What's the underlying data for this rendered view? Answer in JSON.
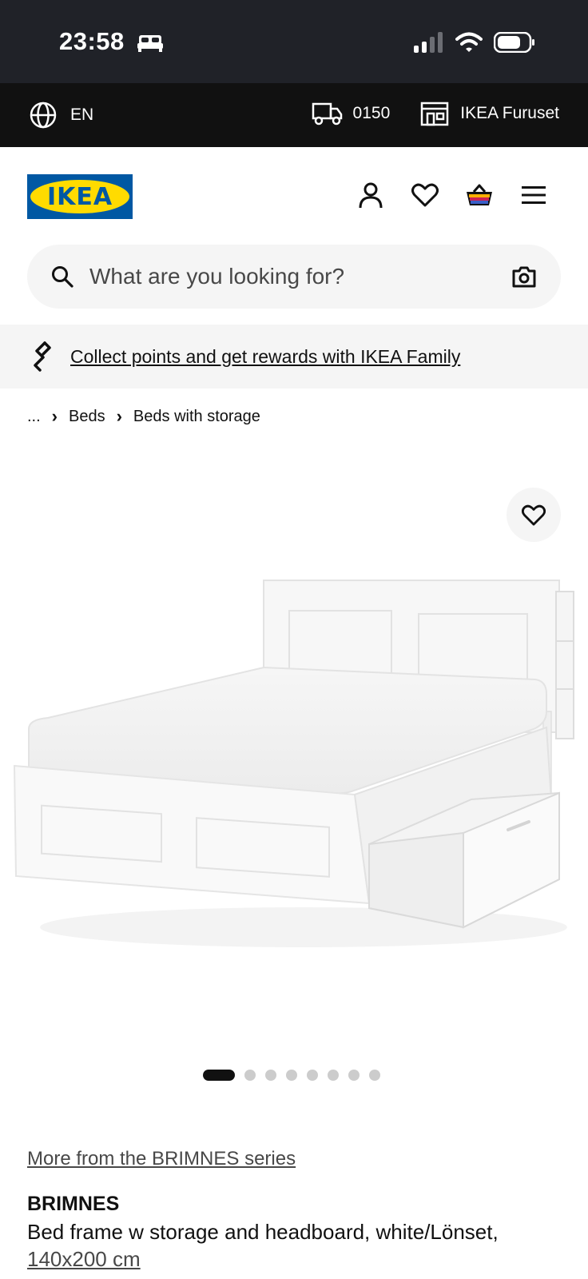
{
  "status_bar": {
    "time": "23:58"
  },
  "util_bar": {
    "language": "EN",
    "postcode": "0150",
    "store": "IKEA Furuset"
  },
  "header": {
    "logo_text": "IKEA"
  },
  "search": {
    "placeholder": "What are you looking for?"
  },
  "family_banner": {
    "text": "Collect points and get rewards with IKEA Family"
  },
  "breadcrumb": {
    "ellipsis": "...",
    "items": [
      "Beds",
      "Beds with storage"
    ]
  },
  "carousel": {
    "total": 8,
    "active": 1
  },
  "product": {
    "series_link": "More from the BRIMNES series",
    "name": "BRIMNES",
    "description": "Bed frame w storage and headboard, white/Lönset,",
    "size": "140x200 cm"
  },
  "colors": {
    "ikea_blue": "#0058a3",
    "ikea_yellow": "#ffdb00",
    "status_bg": "#202228",
    "util_bg": "#111111"
  }
}
